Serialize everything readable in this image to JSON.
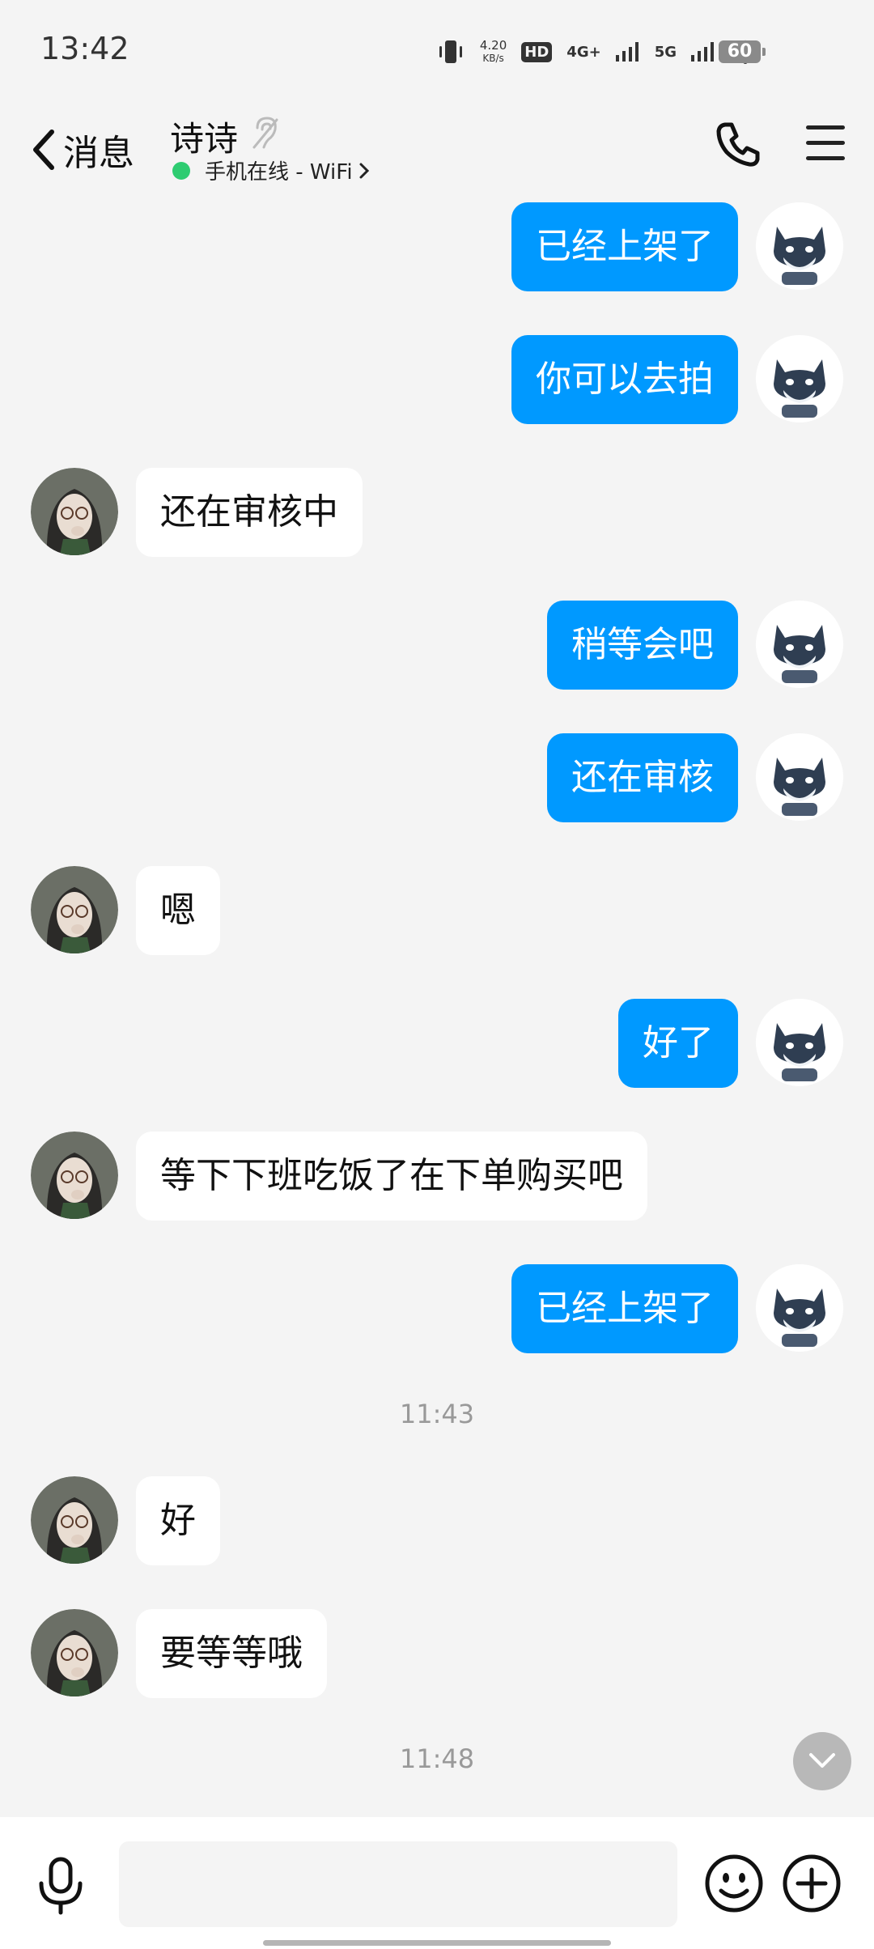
{
  "status_bar": {
    "time": "13:42",
    "net_speed_value": "4.20",
    "net_speed_unit": "KB/s",
    "hd_label": "HD",
    "network_4g": "4G+",
    "network_5g": "5G",
    "battery_level": "60"
  },
  "header": {
    "back_label": "消息",
    "contact_name": "诗诗",
    "online_status": "手机在线 - WiFi"
  },
  "messages": [
    {
      "side": "me",
      "text": "已经上架了"
    },
    {
      "side": "me",
      "text": "你可以去拍"
    },
    {
      "side": "them",
      "text": "还在审核中"
    },
    {
      "side": "me",
      "text": "稍等会吧"
    },
    {
      "side": "me",
      "text": "还在审核"
    },
    {
      "side": "them",
      "text": "嗯"
    },
    {
      "side": "me",
      "text": "好了"
    },
    {
      "side": "them",
      "text": "等下下班吃饭了在下单购买吧"
    },
    {
      "side": "me",
      "text": "已经上架了"
    },
    {
      "side": "them",
      "text": "好"
    },
    {
      "side": "them",
      "text": "要等等哦"
    }
  ],
  "timestamps": [
    "11:43",
    "11:48"
  ],
  "input": {
    "placeholder": ""
  },
  "colors": {
    "my_bubble": "#0099ff",
    "their_bubble": "#ffffff",
    "background": "#f4f4f4",
    "online_dot": "#2ecc71"
  }
}
